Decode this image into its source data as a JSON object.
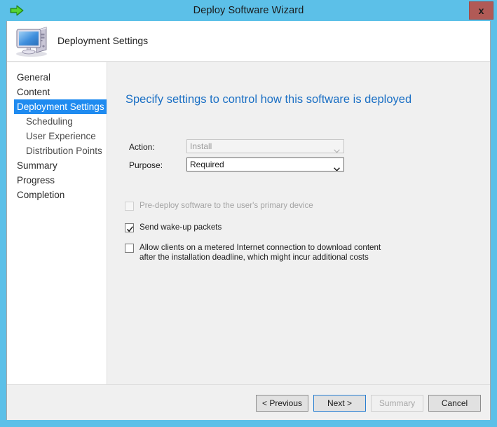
{
  "window": {
    "title": "Deploy Software Wizard",
    "icon": "green-right-arrow-icon",
    "close_label": "x",
    "frame_color": "#5cc0e8",
    "close_color": "#b15a56"
  },
  "header": {
    "title": "Deployment Settings",
    "icon": "computer-icon"
  },
  "nav": {
    "items": [
      {
        "label": "General",
        "level": 0,
        "selected": false
      },
      {
        "label": "Content",
        "level": 0,
        "selected": false
      },
      {
        "label": "Deployment Settings",
        "level": 0,
        "selected": true
      },
      {
        "label": "Scheduling",
        "level": 1,
        "selected": false
      },
      {
        "label": "User Experience",
        "level": 1,
        "selected": false
      },
      {
        "label": "Distribution Points",
        "level": 1,
        "selected": false
      },
      {
        "label": "Summary",
        "level": 0,
        "selected": false
      },
      {
        "label": "Progress",
        "level": 0,
        "selected": false
      },
      {
        "label": "Completion",
        "level": 0,
        "selected": false
      }
    ],
    "selected_color": "#1f8bf0"
  },
  "content": {
    "heading": "Specify settings to control how this software is deployed",
    "heading_color": "#1a6fc4",
    "fields": [
      {
        "label": "Action:",
        "value": "Install",
        "enabled": false
      },
      {
        "label": "Purpose:",
        "value": "Required",
        "enabled": true
      }
    ],
    "checkboxes": [
      {
        "label": "Pre-deploy software to the user's primary device",
        "checked": false,
        "enabled": false,
        "wrap": false
      },
      {
        "label": "Send wake-up packets",
        "checked": true,
        "enabled": true,
        "wrap": false
      },
      {
        "label": "Allow clients on a metered Internet connection to download content after the installation deadline, which might incur additional costs",
        "checked": false,
        "enabled": true,
        "wrap": true
      }
    ]
  },
  "footer": {
    "buttons": [
      {
        "label": "< Previous",
        "state": "normal"
      },
      {
        "label": "Next >",
        "state": "default"
      },
      {
        "label": "Summary",
        "state": "disabled"
      },
      {
        "label": "Cancel",
        "state": "normal"
      }
    ]
  }
}
